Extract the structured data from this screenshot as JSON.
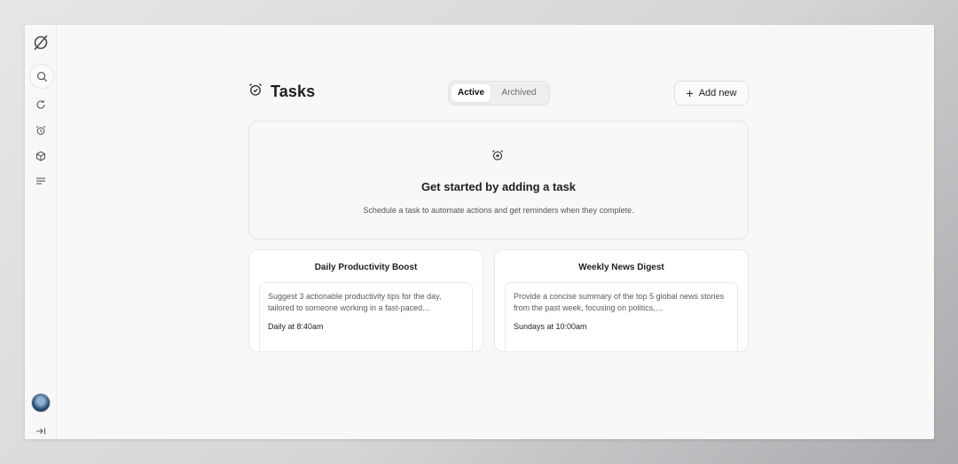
{
  "sidebar": {
    "icons": [
      "logo-icon",
      "search-icon",
      "refresh-icon",
      "alarm-icon",
      "box-icon",
      "menu-icon",
      "avatar",
      "collapse-icon"
    ]
  },
  "header": {
    "title": "Tasks",
    "title_icon": "alarm-clock-icon",
    "tabs": [
      {
        "label": "Active",
        "selected": true
      },
      {
        "label": "Archived",
        "selected": false
      }
    ],
    "add_button": {
      "icon": "+",
      "label": "Add new"
    }
  },
  "empty_state": {
    "icon": "alarm-add-icon",
    "heading": "Get started by adding a task",
    "description": "Schedule a task to automate actions and get reminders when they complete."
  },
  "tasks": [
    {
      "name": "Daily Productivity Boost",
      "description": "Suggest 3 actionable productivity tips for the day, tailored to someone working in a fast-paced…",
      "schedule": "Daily at 8:40am"
    },
    {
      "name": "Weekly News Digest",
      "description": "Provide a concise summary of the top 5 global news stories from the past week, focusing on politics,…",
      "schedule": "Sundays at 10:00am"
    }
  ],
  "colors": {
    "background": "#f8f8f6",
    "text": "#1e1e1e",
    "muted": "#5a5a5a",
    "border": "#e6e6e3"
  }
}
